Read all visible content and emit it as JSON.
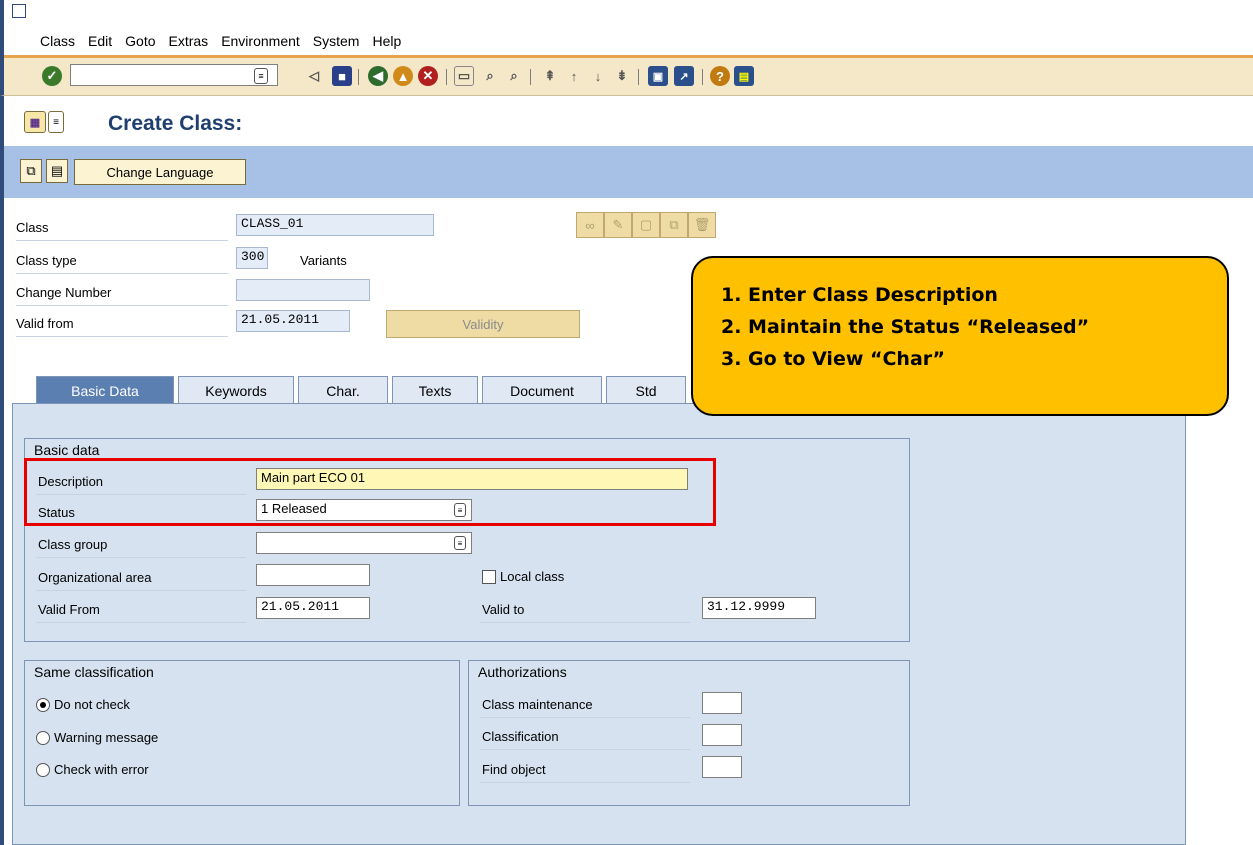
{
  "menu": {
    "items": [
      "Class",
      "Edit",
      "Goto",
      "Extras",
      "Environment",
      "System",
      "Help"
    ]
  },
  "toolbar": {
    "command_value": ""
  },
  "title": {
    "text": "Create Class:"
  },
  "app_toolbar": {
    "change_language_label": "Change Language"
  },
  "header": {
    "class_label": "Class",
    "class_value": "CLASS_01",
    "class_type_label": "Class type",
    "class_type_value": "300",
    "class_type_text": "Variants",
    "change_number_label": "Change Number",
    "change_number_value": "",
    "valid_from_label": "Valid from",
    "valid_from_value": "21.05.2011",
    "validity_button": "Validity"
  },
  "tabs": [
    "Basic Data",
    "Keywords",
    "Char.",
    "Texts",
    "Document",
    "Std"
  ],
  "basic_data": {
    "group_title": "Basic data",
    "description_label": "Description",
    "description_value": "Main part ECO 01",
    "status_label": "Status",
    "status_value": "1 Released",
    "class_group_label": "Class group",
    "class_group_value": "",
    "org_area_label": "Organizational area",
    "org_area_value": "",
    "local_class_label": "Local class",
    "valid_from_label": "Valid From",
    "valid_from_value": "21.05.2011",
    "valid_to_label": "Valid to",
    "valid_to_value": "31.12.9999"
  },
  "same_classification": {
    "group_title": "Same classification",
    "options": [
      "Do not check",
      "Warning message",
      "Check with error"
    ],
    "selected": 0
  },
  "authorizations": {
    "group_title": "Authorizations",
    "class_maintenance_label": "Class maintenance",
    "classification_label": "Classification",
    "find_object_label": "Find object"
  },
  "callout": {
    "items": [
      "1.  Enter Class Description",
      "2.  Maintain the Status “Released”",
      "3.  Go to View “Char”"
    ],
    "color": "#ffc000"
  },
  "colors": {
    "highlight": "#e60000",
    "app_toolbar": "#a7c1e6",
    "tab_active": "#5b7fb0"
  }
}
